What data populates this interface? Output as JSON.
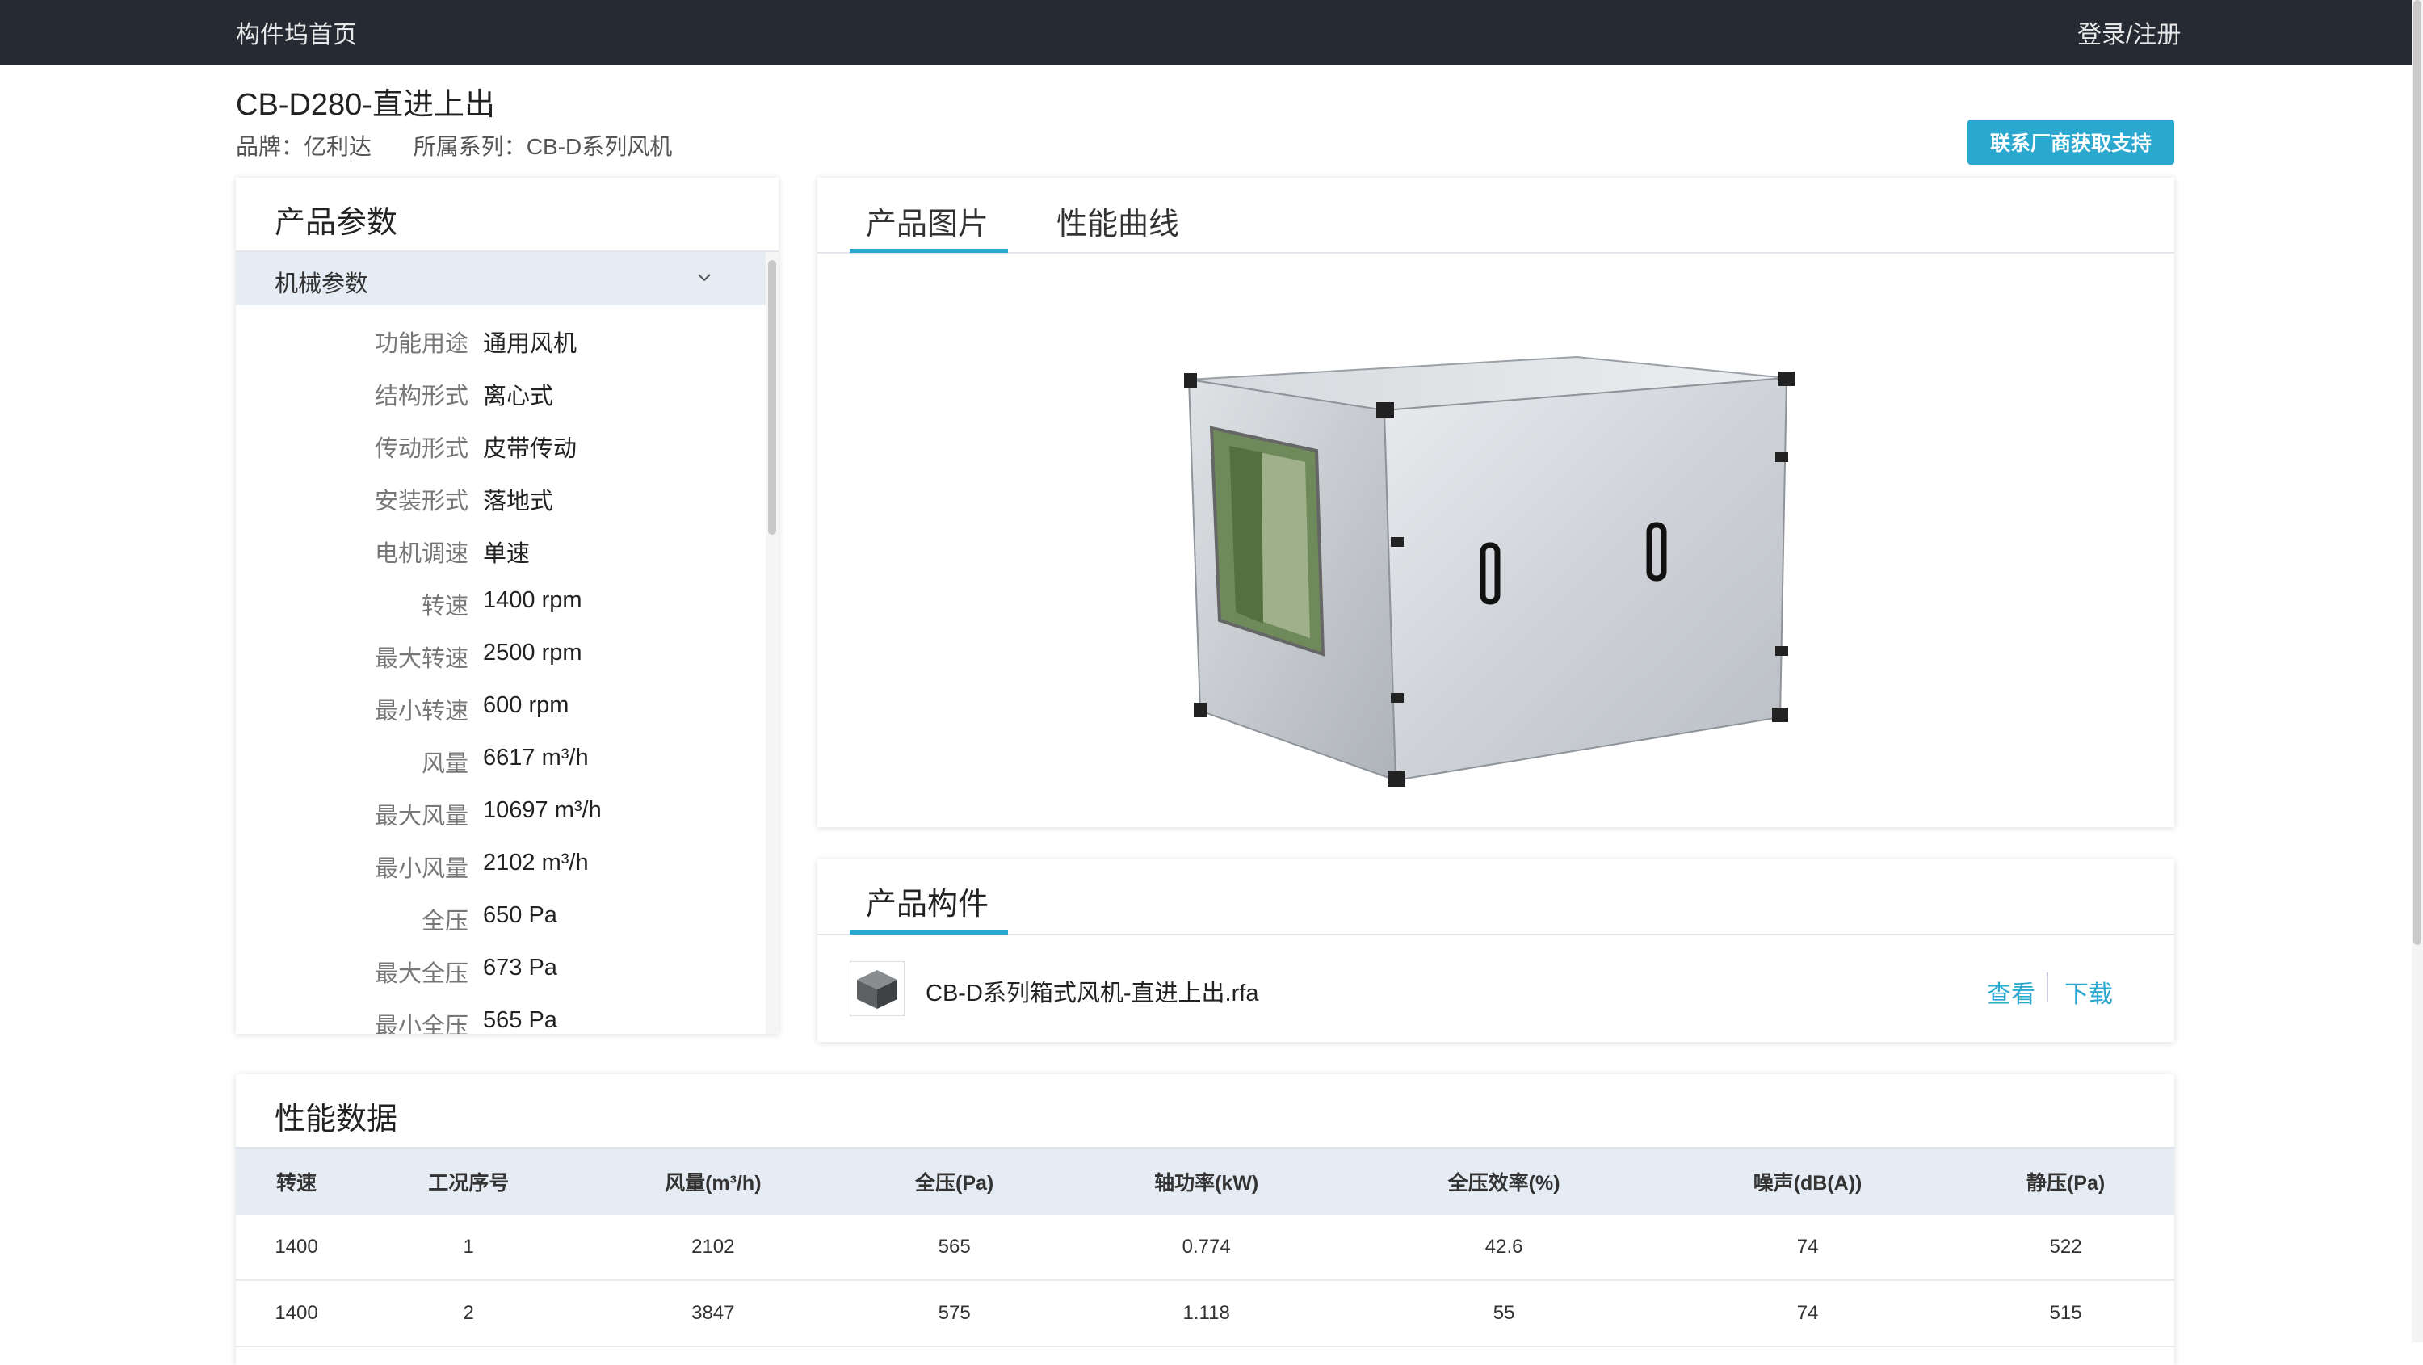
{
  "topbar": {
    "home": "构件坞首页",
    "login": "登录/注册"
  },
  "product": {
    "title": "CB-D280-直进上出",
    "brand": "品牌：亿利达",
    "series": "所属系列：CB-D系列风机",
    "contact_button": "联系厂商获取支持"
  },
  "params": {
    "title": "产品参数",
    "group": "机械参数",
    "rows": [
      {
        "k": "功能用途",
        "v": "通用风机"
      },
      {
        "k": "结构形式",
        "v": "离心式"
      },
      {
        "k": "传动形式",
        "v": "皮带传动"
      },
      {
        "k": "安装形式",
        "v": "落地式"
      },
      {
        "k": "电机调速",
        "v": "单速"
      },
      {
        "k": "转速",
        "v": "1400 rpm"
      },
      {
        "k": "最大转速",
        "v": "2500 rpm"
      },
      {
        "k": "最小转速",
        "v": "600 rpm"
      },
      {
        "k": "风量",
        "v": "6617 m³/h"
      },
      {
        "k": "最大风量",
        "v": "10697 m³/h"
      },
      {
        "k": "最小风量",
        "v": "2102 m³/h"
      },
      {
        "k": "全压",
        "v": "650 Pa"
      },
      {
        "k": "最大全压",
        "v": "673 Pa"
      },
      {
        "k": "最小全压",
        "v": "565 Pa"
      }
    ]
  },
  "image_tabs": {
    "tab1": "产品图片",
    "tab2": "性能曲线"
  },
  "components": {
    "title": "产品构件",
    "file_name": "CB-D系列箱式风机-直进上出.rfa",
    "view": "查看",
    "download": "下载"
  },
  "performance": {
    "title": "性能数据",
    "headers": [
      "转速",
      "工况序号",
      "风量(m³/h)",
      "全压(Pa)",
      "轴功率(kW)",
      "全压效率(%)",
      "噪声(dB(A))",
      "静压(Pa)"
    ],
    "rows": [
      [
        "1400",
        "1",
        "2102",
        "565",
        "0.774",
        "42.6",
        "74",
        "522"
      ],
      [
        "1400",
        "2",
        "3847",
        "575",
        "1.118",
        "55",
        "74",
        "515"
      ]
    ]
  },
  "colors": {
    "topbar": "#262a33",
    "accent": "#2aa8d0",
    "header_bg": "#e6ecf3"
  }
}
